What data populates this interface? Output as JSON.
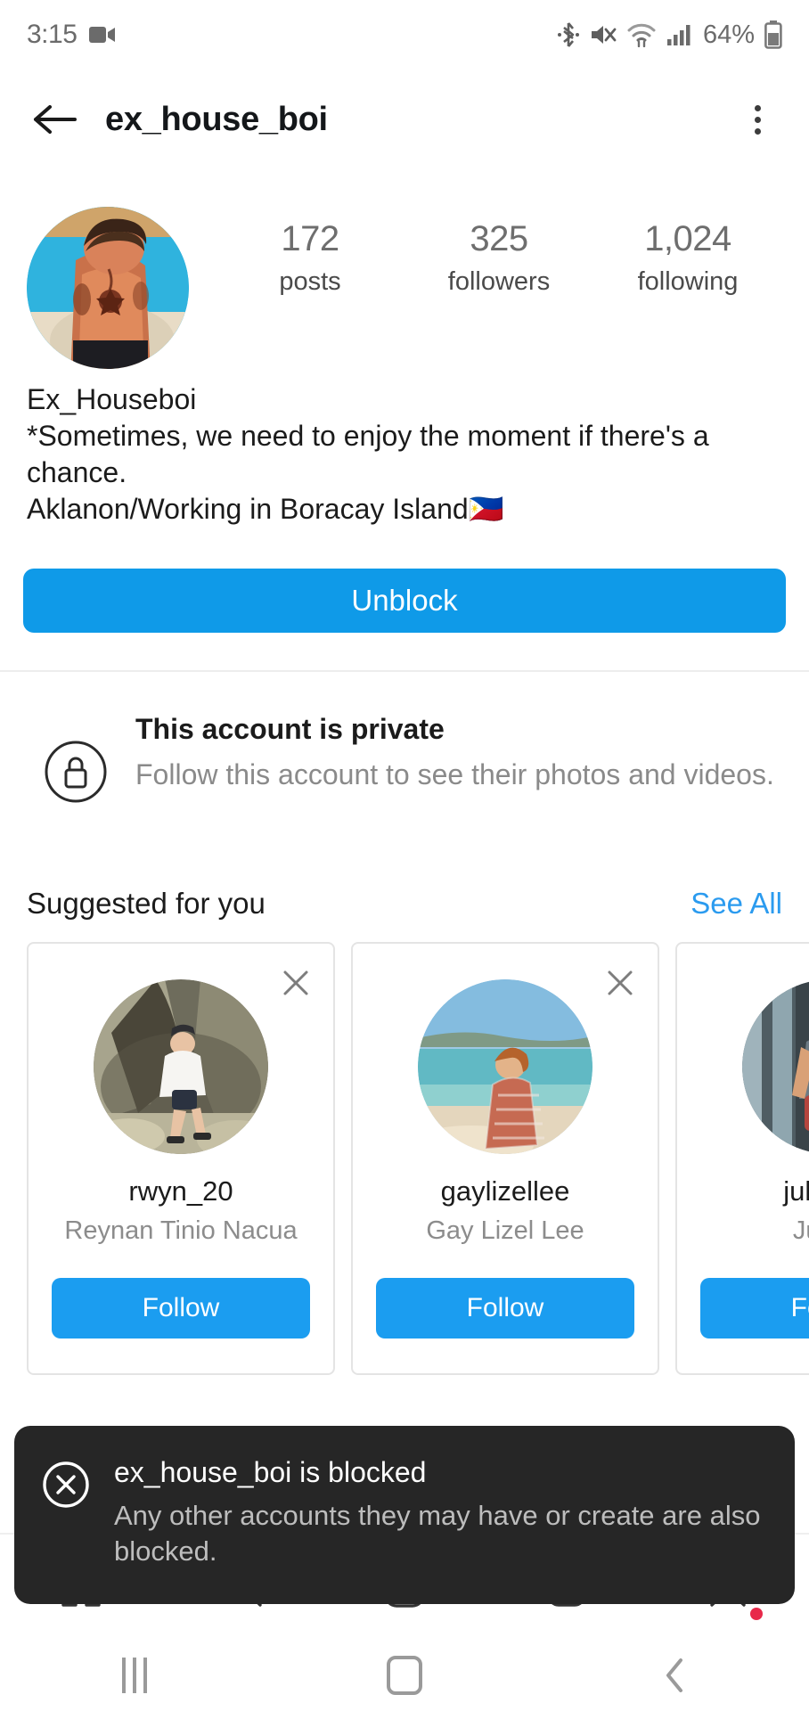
{
  "status_bar": {
    "time": "3:15",
    "battery_text": "64%",
    "icons": [
      "video-recording-icon",
      "bluetooth-icon",
      "mute-icon",
      "wifi-icon",
      "cellular-signal-icon",
      "battery-icon"
    ]
  },
  "header": {
    "back_icon": "back-arrow-icon",
    "username": "ex_house_boi",
    "menu_icon": "overflow-menu-icon"
  },
  "profile": {
    "avatar_alt": "profile-photo",
    "stats": [
      {
        "value": "172",
        "label": "posts"
      },
      {
        "value": "325",
        "label": "followers"
      },
      {
        "value": "1,024",
        "label": "following"
      }
    ],
    "display_name": "Ex_Houseboi",
    "bio_lines": [
      "*Sometimes, we need to enjoy the moment if there's a",
      "chance.",
      "Aklanon/Working in Boracay Island🇵🇭"
    ],
    "action_button": "Unblock",
    "action_color": "#0f9ae8"
  },
  "private_notice": {
    "icon": "lock-icon",
    "title": "This account is private",
    "subtitle": "Follow this account to see their photos and videos."
  },
  "suggested": {
    "title": "Suggested for you",
    "see_all": "See All",
    "link_color": "#2b9bef",
    "cards": [
      {
        "username": "rwyn_20",
        "fullname": "Reynan Tinio Nacua",
        "follow_label": "Follow",
        "dismiss_icon": "close-icon"
      },
      {
        "username": "gaylizellee",
        "fullname": "Gay Lizel Lee",
        "follow_label": "Follow",
        "dismiss_icon": "close-icon"
      },
      {
        "username": "juliusyo",
        "fullname": "Juls G",
        "follow_label": "Follow",
        "dismiss_icon": "close-icon"
      }
    ]
  },
  "bottom_nav": {
    "items": [
      "home-icon",
      "search-icon",
      "add-post-icon",
      "reels-icon",
      "profile-icon"
    ]
  },
  "toast": {
    "icon": "blocked-circle-x-icon",
    "title": "ex_house_boi is blocked",
    "subtitle": "Any other accounts they may have or create are also blocked.",
    "background": "#262626"
  },
  "system_nav": {
    "recents_icon": "recents-icon",
    "home_icon": "home-square-icon",
    "back_icon": "back-chevron-icon"
  }
}
